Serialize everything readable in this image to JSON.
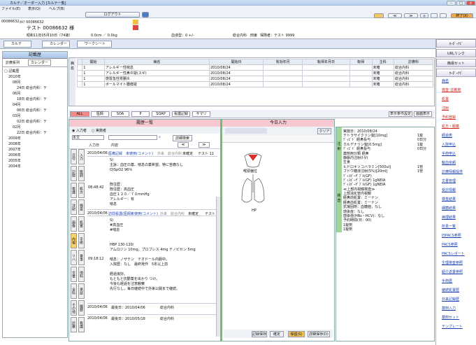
{
  "window": {
    "title": "カルテ／オーダー入力 [カルテ一覧]"
  },
  "menu": [
    "ファイル(E)",
    "表示(Q)",
    "ヘルプ(B)"
  ],
  "toolbar": {
    "logout": "ログアウト",
    "end": "終了(X)",
    "nav_prev": "≪",
    "nav_next": "≫"
  },
  "patient": {
    "id_label": "00086632",
    "id_sub": "ｶﾙﾃ 00086632",
    "name": "テスト 00086632 様",
    "dob": "昭和11年05月10日（74歳）",
    "height_weight": "0.0cm ／ 0.0kg",
    "blood_type": "血液型：0 +/-",
    "ward": "総合内科",
    "doctor": "田東",
    "insurer_label": "保険者：テスト 9999"
  },
  "tabs": [
    "カルテ",
    "カレンダー",
    "ワークシート"
  ],
  "left": {
    "title": "記載歴",
    "tab1": "診療系列",
    "tab2": "カレンダー",
    "root": "記載歴",
    "tree": [
      {
        "label": "2010年",
        "level": 1
      },
      {
        "label": "08月",
        "level": 2
      },
      {
        "label": "24日 総合内科：テ",
        "level": 3
      },
      {
        "label": "06月",
        "level": 2
      },
      {
        "label": "18日 総合内科：テ",
        "level": 3
      },
      {
        "label": "04月",
        "level": 2
      },
      {
        "label": "06日 総合内科：テ",
        "level": 3
      },
      {
        "label": "03月",
        "level": 2
      },
      {
        "label": "02日 総合内科：テ",
        "level": 3
      },
      {
        "label": "02月",
        "level": 2
      },
      {
        "label": "22日 総合内科：テ",
        "level": 3
      },
      {
        "label": "2009年",
        "level": 1
      },
      {
        "label": "2008年",
        "level": 1
      },
      {
        "label": "2007年",
        "level": 1
      },
      {
        "label": "2006年",
        "level": 1
      },
      {
        "label": "2005年",
        "level": 1
      },
      {
        "label": "2004年",
        "level": 1
      }
    ]
  },
  "orders": {
    "side_label": "病名",
    "headers": [
      "",
      "開始",
      "病名",
      "開始日",
      "有効年月",
      "転帰年月日",
      "転帰",
      "主科",
      "診療科"
    ],
    "rows": [
      [
        "1",
        "アレルギー性喘息",
        "2010/08/24",
        "",
        "",
        "",
        "未確",
        "総合内科"
      ],
      [
        "1",
        "アレルギー性鼻炎疑(スギ)",
        "2010/08/24",
        "",
        "",
        "",
        "未確",
        "総合内科"
      ],
      [
        "1",
        "感冒急性胃腸炎",
        "2010/08/24",
        "",
        "",
        "",
        "未確",
        "総合内科"
      ],
      [
        "1",
        "ボールマイト腫瘍疑",
        "2010/08/24",
        "",
        "",
        "",
        "未確",
        "総合内科"
      ]
    ]
  },
  "filters": [
    "ALL",
    "医師",
    "SOA",
    "P",
    "SOAP",
    "看護記録",
    "サマリ"
  ],
  "filter_right": [
    "表示条件設定",
    "画面表示"
  ],
  "history": {
    "title": "履歴一覧",
    "radio1": "入力者",
    "radio2": "実施者",
    "select": "本文",
    "search_btn": "詳細検索",
    "col_date": "入力日",
    "col_content": "内容",
    "entries": [
      {
        "date": "2010/04/06",
        "author": "医療記録",
        "sub": "未使用(コメント)",
        "dept": "外来　総合内科",
        "status": "未確定",
        "who": "テスト 11"
      },
      {
        "date": "2010/04/06",
        "author": "訪問看護(医師)",
        "sub": "未使用(コメント)",
        "dept": "外来　総合内科",
        "status": "未確定",
        "who": "テスト"
      }
    ],
    "text1": [
      "S)",
      "主訴：血圧の薬、喘息の薬希望。特に苦痛なし",
      "O)SpO2 96％",
      "",
      "",
      "既往歴：",
      "既往歴：高血圧",
      "血圧１２０／７０mmHg",
      "アレルギー：有",
      "喘息"
    ],
    "time1": "08:48:42",
    "text2": [
      "S)",
      "#高血圧",
      "#喘息",
      "",
      "",
      "HBP 130-120/",
      "アムロジン 10mg，プロブレス 4mg  テノビセン 5mg",
      "",
      "喘息：ノザテン　テオドール内服中。",
      "入院歴：なし　最終発作　5年以上前",
      "",
      "経過良好。",
      "もともと抗鬱薬を出かり つけ。",
      "今後も経過を注意観察",
      "先行なし，毎日継続中で外来公開まで継続。"
    ],
    "time2": "09:18:12",
    "footer": [
      {
        "date": "2010/04/06",
        "label": "最後日：2010/04/06",
        "dept": "総合内科"
      },
      {
        "date": "2010/04/06",
        "label": "最後日：2010/05/18",
        "dept": "総合内科"
      }
    ],
    "side_tabs": [
      "日付",
      "入力",
      "記録",
      "医師",
      "看護",
      "処方",
      "注射",
      "検査",
      "画像",
      "処置",
      "内視",
      "手術",
      "リハ",
      "食事",
      "文書",
      "他科",
      "全科",
      "承認",
      "その他",
      "履歴",
      "診察",
      "看護"
    ]
  },
  "today": {
    "title": "今日入力",
    "clear": "クリア",
    "diagram_label1": "喉頭偏位",
    "diagram_label2": "HP",
    "save": "記録保存",
    "confirm": "確定",
    "pending": "保留(S)",
    "detail": "詳細保存(D)"
  },
  "order_panel": {
    "date": "実施日：2010/08/24",
    "lines": [
      "テトラサイクリン錠[10mg]",
      "ﾃﾞｨﾋﾞﾄﾞ 経鼻投与",
      "カルデナリン錠[0.5mg]",
      "ﾃﾞｨﾋﾞﾄﾞ 経鼻投与",
      "薬剤用分類 経鼻",
      "静脈内注射(I-V)",
      "生食",
      "ヒドロキソコバラミン[500ul]",
      "ブドウ糖液注射(5%)[20ml]",
      "ﾃﾞｨｽﾎﾟｰｻﾞﾌﾞﾙ(GF)",
      "ﾃﾞｨｽﾎﾟｰｻﾞﾌﾞﾙ(GF) 1gNEIA",
      "ﾃﾞｨｽﾎﾟｰｻﾞﾌﾞﾙ(GF) 1gNEIA",
      "≪上部内視鏡検査≫",
      "上部消化管内視鏡",
      "経鼻前処置：ミーナン",
      "経鼻前処置：ミーナン",
      "抗凝固剤：血糖値，なし",
      "感染症：なし",
      "感染症(HBs・HCV)：なし",
      "予約時間(日：00)",
      "1錠剤",
      "1錠剤"
    ],
    "qty": [
      "1錠",
      "0日分",
      "1錠",
      "0日分",
      "",
      "",
      "",
      "1管",
      "1管",
      "",
      "",
      "",
      "",
      "",
      "",
      "",
      "",
      "",
      "",
      "",
      "",
      ""
    ],
    "side": [
      "注 射",
      "検 査"
    ]
  },
  "right": {
    "head1": "ｵｰﾀﾞｰﾅﾋﾞ",
    "links_top": [
      "URLリンク",
      "簡易セット",
      "ｵｰﾀﾞｰﾅﾋﾞ"
    ],
    "links": [
      {
        "label": "病名",
        "red": false
      },
      {
        "label": "検査･診断検",
        "red": true
      },
      {
        "label": "処置",
        "red": true
      },
      {
        "label": "注射",
        "red": true
      },
      {
        "label": "予約登録",
        "red": true
      },
      {
        "label": "処方・服薬",
        "red": true
      },
      {
        "label": "経過表",
        "red": false
      },
      {
        "label": "入院申込",
        "red": false
      },
      {
        "label": "手術申込",
        "red": false
      },
      {
        "label": "輸血依頼",
        "red": false
      },
      {
        "label": "診療情報提供",
        "red": false
      },
      {
        "label": "文書管理",
        "red": false
      },
      {
        "label": "受診情報",
        "red": false
      },
      {
        "label": "検査結果",
        "red": false
      },
      {
        "label": "細菌結果",
        "red": false
      },
      {
        "label": "病理結果",
        "red": false
      },
      {
        "label": "所見一覧",
        "red": false
      },
      {
        "label": "旧PACS参照",
        "red": false
      },
      {
        "label": "PACS参照",
        "red": false
      },
      {
        "label": "PACSレポート",
        "red": false
      },
      {
        "label": "生理検査参照",
        "red": false
      },
      {
        "label": "紹介返書参照",
        "red": false
      },
      {
        "label": "手術歴",
        "red": false
      },
      {
        "label": "継続処置歴",
        "red": false
      },
      {
        "label": "外来記録歴",
        "red": false
      },
      {
        "label": "薬剤入力",
        "red": false
      },
      {
        "label": "薬剤セット",
        "red": false
      },
      {
        "label": "テンプレート",
        "red": false
      }
    ]
  }
}
